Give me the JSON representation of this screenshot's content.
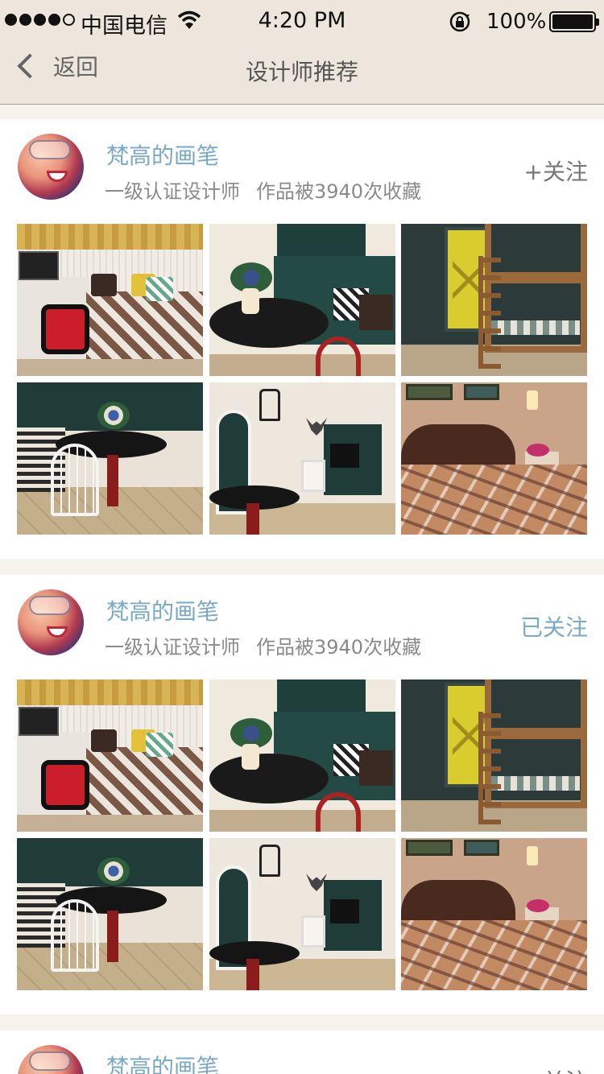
{
  "status_bar": {
    "carrier": "中国电信",
    "time": "4:20 PM",
    "battery": "100%"
  },
  "nav": {
    "back_label": "返回",
    "title": "设计师推荐"
  },
  "designers": [
    {
      "name": "梵高的画笔",
      "level": "一级认证设计师",
      "favorites": "作品被3940次收藏",
      "follow_label": "+关注",
      "followed": false
    },
    {
      "name": "梵高的画笔",
      "level": "一级认证设计师",
      "favorites": "作品被3940次收藏",
      "follow_label": "已关注",
      "followed": true
    },
    {
      "name": "梵高的画笔",
      "follow_label": "关注",
      "followed": false
    }
  ],
  "colors": {
    "accent": "#7aaac5",
    "background": "#f6f2ec",
    "header": "#ece6dc"
  },
  "icons": [
    "signal-icon",
    "wifi-icon",
    "rotation-lock-icon",
    "battery-icon",
    "back-chevron-icon"
  ]
}
